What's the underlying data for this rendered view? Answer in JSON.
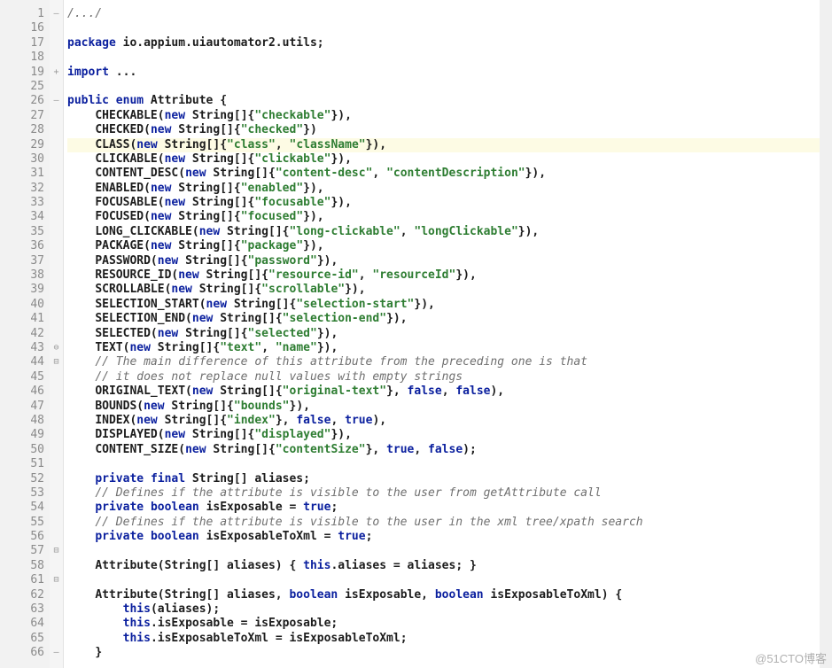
{
  "gutter_lines": [
    "1",
    "16",
    "17",
    "18",
    "19",
    "25",
    "26",
    "27",
    "28",
    "29",
    "30",
    "31",
    "32",
    "33",
    "34",
    "35",
    "36",
    "37",
    "38",
    "39",
    "40",
    "41",
    "42",
    "43",
    "44",
    "45",
    "46",
    "47",
    "48",
    "49",
    "50",
    "51",
    "52",
    "53",
    "54",
    "55",
    "56",
    "57",
    "58",
    "61",
    "62",
    "63",
    "64",
    "65",
    "66"
  ],
  "fold_markers": {
    "0": "–",
    "4": "+",
    "6": "–",
    "23": "⊖",
    "24": "⊟",
    "37": "⊟",
    "39": "⊟",
    "44": "–"
  },
  "highlight_index": 9,
  "s": {
    "package": "package",
    "import": "import",
    "public": "public",
    "enum": "enum",
    "new": "new",
    "private": "private",
    "final": "final",
    "boolean": "boolean",
    "this": "this",
    "true": "true",
    "false": "false"
  },
  "code": [
    {
      "t": "com",
      "text": "/.../"
    },
    {
      "t": "blank"
    },
    {
      "pkg": " io.appium.uiautomator2.utils;"
    },
    {
      "t": "blank"
    },
    {
      "imp": " ..."
    },
    {
      "t": "blank"
    },
    {
      "decl": " Attribute {"
    },
    {
      "enum": "CHECKABLE",
      "strs": [
        "\"checkable\""
      ],
      "tail": "}),"
    },
    {
      "enum": "CHECKED",
      "strs": [
        "\"checked\""
      ],
      "tail": "})"
    },
    {
      "enum": "CLASS",
      "strs": [
        "\"class\"",
        "\"className\""
      ],
      "tail": "}),"
    },
    {
      "enum": "CLICKABLE",
      "strs": [
        "\"clickable\""
      ],
      "tail": "}),"
    },
    {
      "enum": "CONTENT_DESC",
      "strs": [
        "\"content-desc\"",
        "\"contentDescription\""
      ],
      "tail": "}),"
    },
    {
      "enum": "ENABLED",
      "strs": [
        "\"enabled\""
      ],
      "tail": "}),"
    },
    {
      "enum": "FOCUSABLE",
      "strs": [
        "\"focusable\""
      ],
      "tail": "}),"
    },
    {
      "enum": "FOCUSED",
      "strs": [
        "\"focused\""
      ],
      "tail": "}),"
    },
    {
      "enum": "LONG_CLICKABLE",
      "strs": [
        "\"long-clickable\"",
        "\"longClickable\""
      ],
      "tail": "}),"
    },
    {
      "enum": "PACKAGE",
      "strs": [
        "\"package\""
      ],
      "tail": "}),"
    },
    {
      "enum": "PASSWORD",
      "strs": [
        "\"password\""
      ],
      "tail": "}),"
    },
    {
      "enum": "RESOURCE_ID",
      "strs": [
        "\"resource-id\"",
        "\"resourceId\""
      ],
      "tail": "}),"
    },
    {
      "enum": "SCROLLABLE",
      "strs": [
        "\"scrollable\""
      ],
      "tail": "}),"
    },
    {
      "enum": "SELECTION_START",
      "strs": [
        "\"selection-start\""
      ],
      "tail": "}),"
    },
    {
      "enum": "SELECTION_END",
      "strs": [
        "\"selection-end\""
      ],
      "tail": "}),"
    },
    {
      "enum": "SELECTED",
      "strs": [
        "\"selected\""
      ],
      "tail": "}),"
    },
    {
      "enum": "TEXT",
      "strs": [
        "\"text\"",
        "\"name\""
      ],
      "tail": "}),"
    },
    {
      "t": "com",
      "indent": 2,
      "text": "// The main difference of this attribute from the preceding one is that"
    },
    {
      "t": "com",
      "indent": 2,
      "text": "// it does not replace null values with empty strings"
    },
    {
      "enum": "ORIGINAL_TEXT",
      "strs": [
        "\"original-text\""
      ],
      "extras": [
        "false",
        "false"
      ],
      "tail": "),"
    },
    {
      "enum": "BOUNDS",
      "strs": [
        "\"bounds\""
      ],
      "tail": "}),"
    },
    {
      "enum": "INDEX",
      "strs": [
        "\"index\""
      ],
      "extras": [
        "false",
        "true"
      ],
      "tail": "),"
    },
    {
      "enum": "DISPLAYED",
      "strs": [
        "\"displayed\""
      ],
      "tail": "}),"
    },
    {
      "enum": "CONTENT_SIZE",
      "strs": [
        "\"contentSize\""
      ],
      "extras": [
        "true",
        "false"
      ],
      "tail": ");"
    },
    {
      "t": "blank"
    },
    {
      "field": "String[] aliases;",
      "mods": [
        "private",
        "final"
      ]
    },
    {
      "t": "com",
      "indent": 2,
      "text": "// Defines if the attribute is visible to the user from getAttribute call"
    },
    {
      "field": "isExposable = ",
      "mods": [
        "private",
        "boolean"
      ],
      "val": "true",
      "end": ";"
    },
    {
      "t": "com",
      "indent": 2,
      "text": "// Defines if the attribute is visible to the user in the xml tree/xpath search"
    },
    {
      "field": "isExposableToXml = ",
      "mods": [
        "private",
        "boolean"
      ],
      "val": "true",
      "end": ";"
    },
    {
      "t": "blank"
    },
    {
      "ctor1": "Attribute(String[] aliases) { ",
      "ctor2": ".aliases = aliases; ",
      "ctor3": "}"
    },
    {
      "t": "blank"
    },
    {
      "ctor_open": "Attribute(String[] aliases, "
    },
    {
      "body": "(aliases);"
    },
    {
      "body": ".isExposable = isExposable;"
    },
    {
      "body": ".isExposableToXml = isExposableToXml;"
    },
    {
      "close": "}"
    }
  ],
  "watermark": "@51CTO博客"
}
